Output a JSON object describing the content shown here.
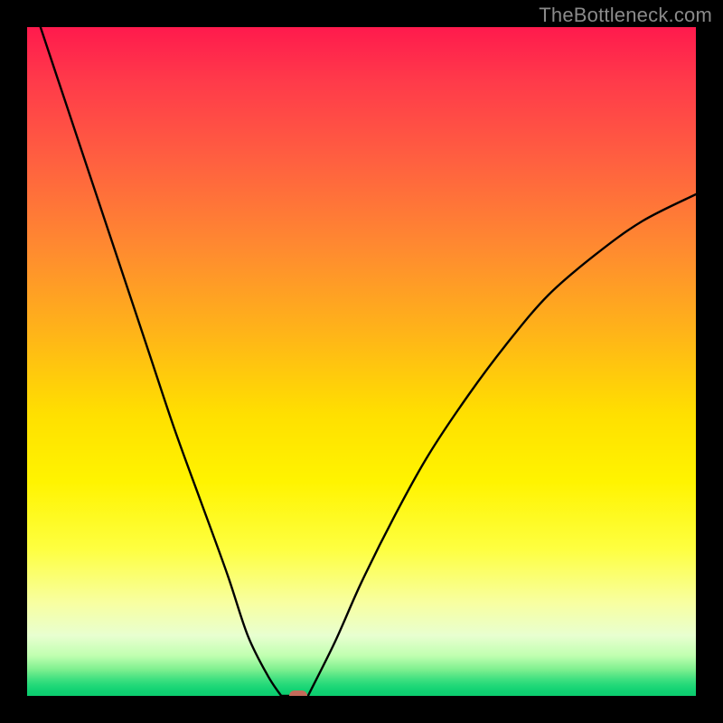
{
  "watermark": {
    "text": "TheBottleneck.com"
  },
  "chart_data": {
    "type": "line",
    "title": "",
    "xlabel": "",
    "ylabel": "",
    "xlim": [
      0,
      100
    ],
    "ylim": [
      0,
      100
    ],
    "grid": false,
    "legend": false,
    "gradient_stops": [
      {
        "pos": 0.0,
        "color": "#ff1a4d"
      },
      {
        "pos": 0.2,
        "color": "#ff6040"
      },
      {
        "pos": 0.46,
        "color": "#ffb518"
      },
      {
        "pos": 0.68,
        "color": "#fff400"
      },
      {
        "pos": 0.86,
        "color": "#f8ffa0"
      },
      {
        "pos": 0.96,
        "color": "#80f090"
      },
      {
        "pos": 1.0,
        "color": "#0ccc6e"
      }
    ],
    "series": [
      {
        "name": "left-branch",
        "x": [
          2,
          6,
          10,
          14,
          18,
          22,
          26,
          30,
          33,
          36,
          38
        ],
        "y": [
          100,
          88,
          76,
          64,
          52,
          40,
          29,
          18,
          9,
          3,
          0
        ]
      },
      {
        "name": "floor",
        "x": [
          38,
          42
        ],
        "y": [
          0,
          0
        ]
      },
      {
        "name": "right-branch",
        "x": [
          42,
          46,
          50,
          55,
          60,
          66,
          72,
          78,
          85,
          92,
          100
        ],
        "y": [
          0,
          8,
          17,
          27,
          36,
          45,
          53,
          60,
          66,
          71,
          75
        ]
      }
    ],
    "marker": {
      "x": 40.5,
      "y": 0,
      "color": "#c46a5a"
    }
  }
}
